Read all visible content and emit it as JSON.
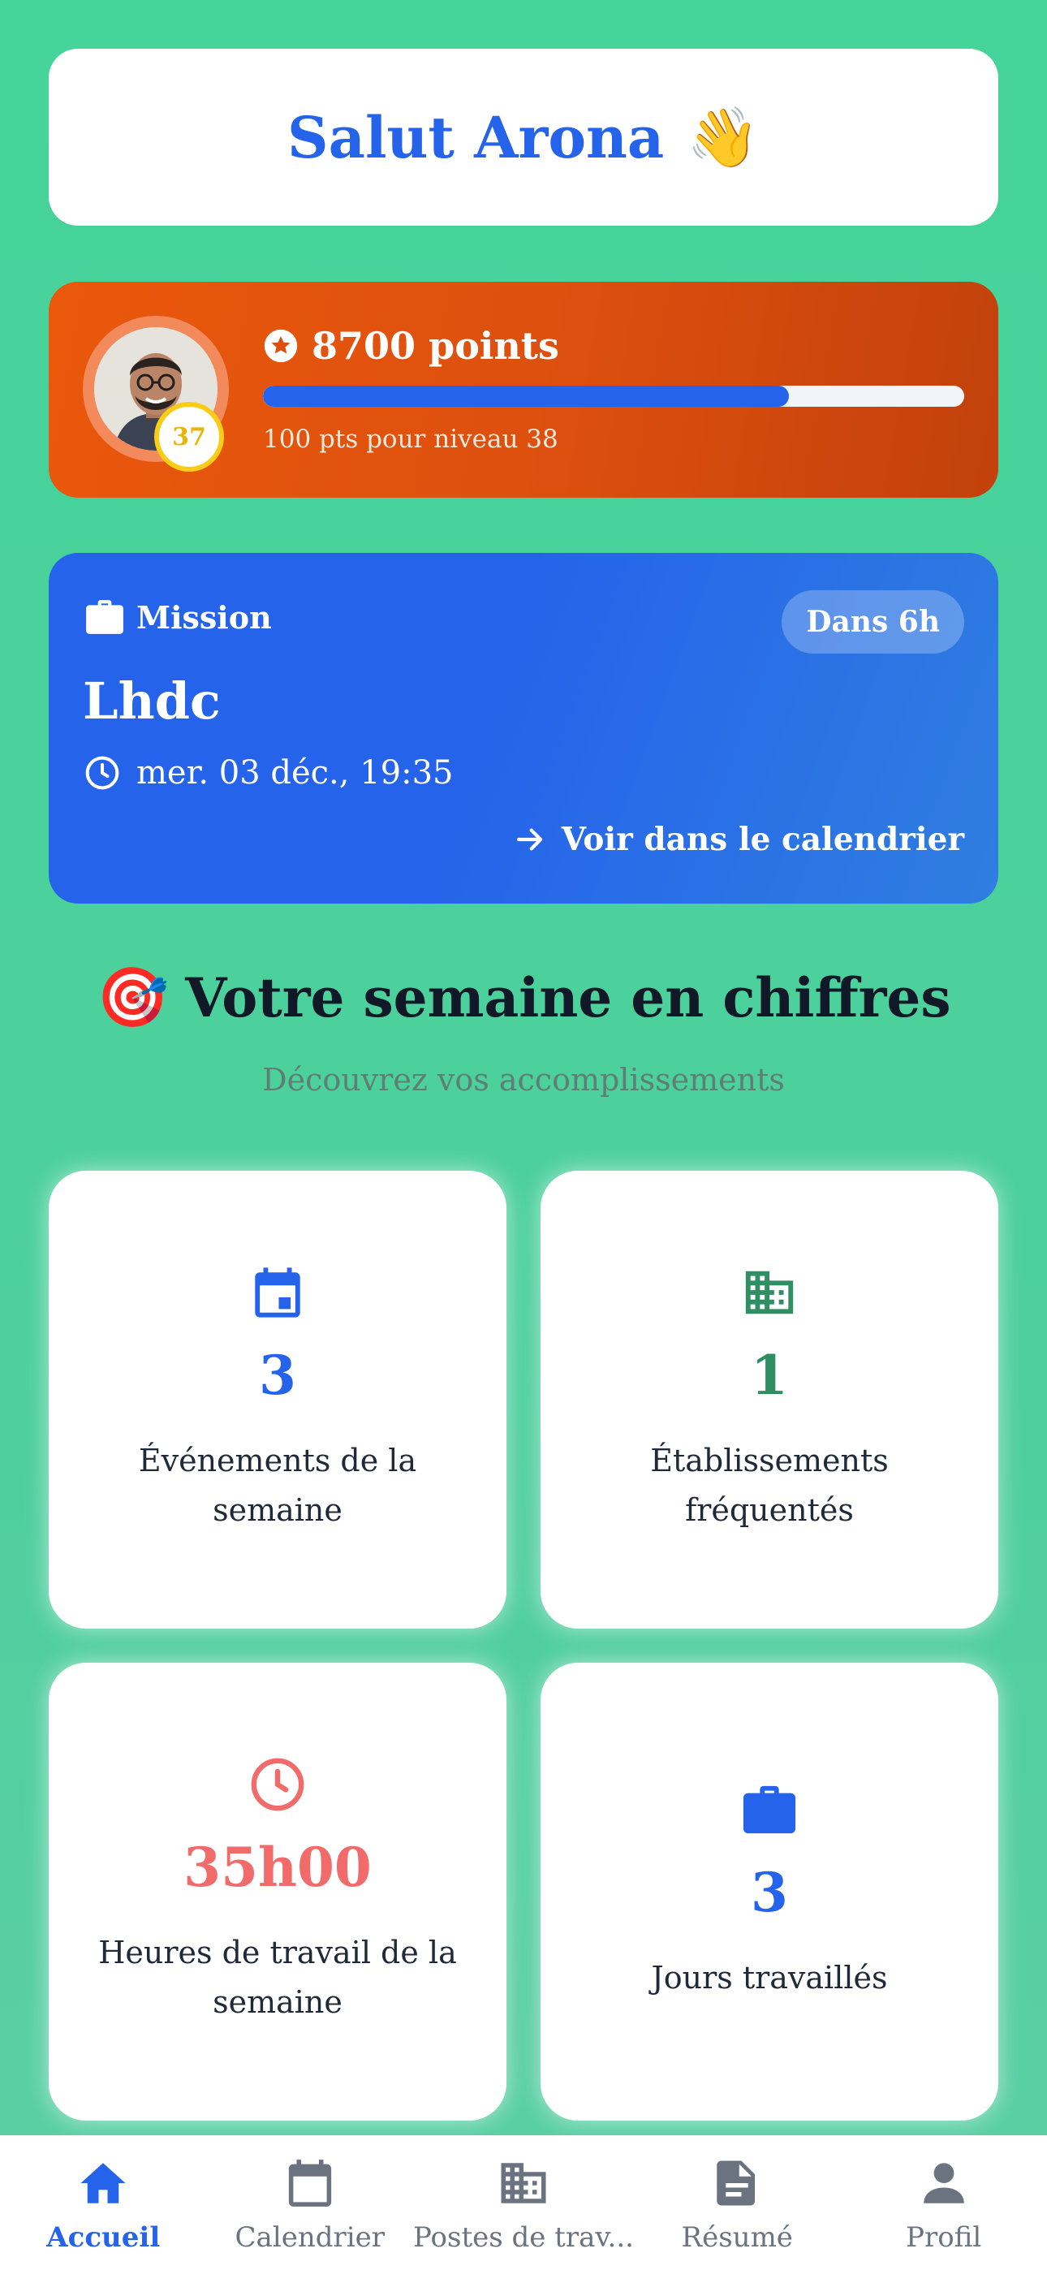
{
  "greeting": {
    "text": "Salut Arona",
    "emoji": "👋"
  },
  "points_card": {
    "level": "37",
    "points_text": "8700 points",
    "progress_fraction": 0.75,
    "subtext": "100 pts pour niveau 38"
  },
  "mission": {
    "label": "Mission",
    "chip": "Dans 6h",
    "title": "Lhdc",
    "datetime": "mer. 03 déc., 19:35",
    "link": "Voir dans le calendrier"
  },
  "week": {
    "emoji": "🎯",
    "title": "Votre semaine en chiffres",
    "subtitle": "Découvrez vos accomplissements"
  },
  "stats": [
    {
      "icon": "calendar-icon",
      "value": "3",
      "label": "Événements de la semaine",
      "color": "#2563eb"
    },
    {
      "icon": "building-icon",
      "value": "1",
      "label": "Établissements fréquentés",
      "color": "#2f8f63"
    },
    {
      "icon": "clock-icon",
      "value": "35h00",
      "label": "Heures de travail de la semaine",
      "color": "#f26b6b"
    },
    {
      "icon": "briefcase-icon",
      "value": "3",
      "label": "Jours travaillés",
      "color": "#2563eb"
    }
  ],
  "nav": [
    {
      "label": "Accueil",
      "icon": "home-icon",
      "active": true
    },
    {
      "label": "Calendrier",
      "icon": "calendar-icon",
      "active": false
    },
    {
      "label": "Postes de trav...",
      "icon": "building-icon",
      "active": false
    },
    {
      "label": "Résumé",
      "icon": "document-icon",
      "active": false
    },
    {
      "label": "Profil",
      "icon": "person-icon",
      "active": false
    }
  ],
  "colors": {
    "background": "#45d49a",
    "primary": "#2563eb",
    "points_card": "#ea580c",
    "badge": "#facc15"
  }
}
